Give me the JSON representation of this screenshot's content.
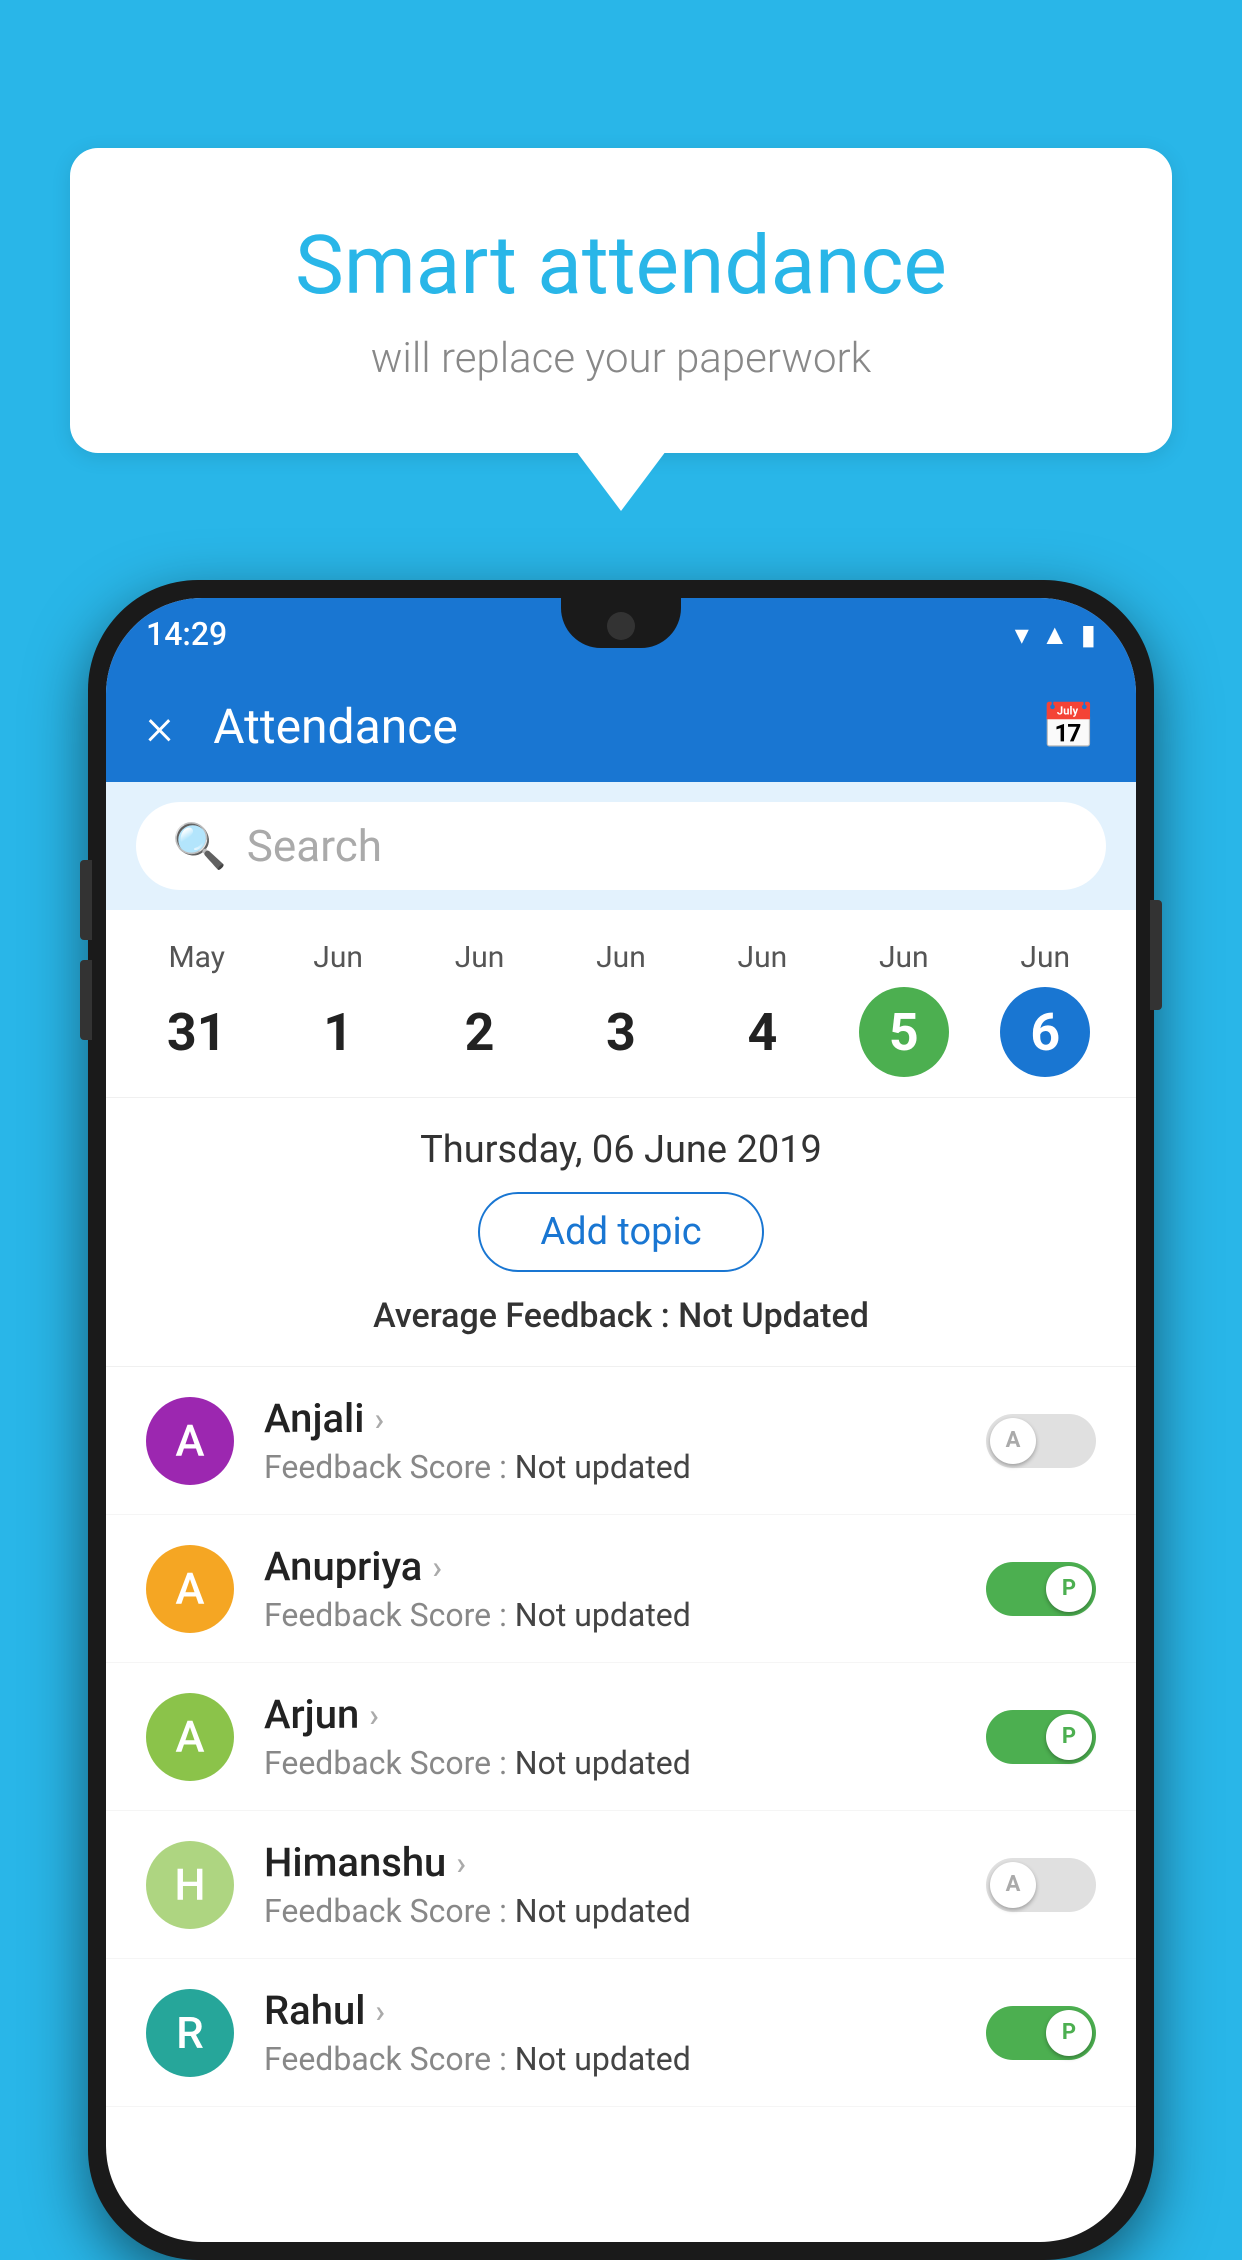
{
  "background": {
    "color": "#29b6e8"
  },
  "speech_bubble": {
    "title": "Smart attendance",
    "subtitle": "will replace your paperwork"
  },
  "phone": {
    "status_bar": {
      "time": "14:29",
      "icons": [
        "wifi",
        "signal",
        "battery"
      ]
    },
    "app_bar": {
      "title": "Attendance",
      "close_label": "×",
      "calendar_icon": "📅"
    },
    "search": {
      "placeholder": "Search"
    },
    "calendar": {
      "days": [
        {
          "month": "May",
          "date": "31",
          "style": "normal"
        },
        {
          "month": "Jun",
          "date": "1",
          "style": "normal"
        },
        {
          "month": "Jun",
          "date": "2",
          "style": "normal"
        },
        {
          "month": "Jun",
          "date": "3",
          "style": "normal"
        },
        {
          "month": "Jun",
          "date": "4",
          "style": "normal"
        },
        {
          "month": "Jun",
          "date": "5",
          "style": "green"
        },
        {
          "month": "Jun",
          "date": "6",
          "style": "blue"
        }
      ]
    },
    "selected_date": {
      "label": "Thursday, 06 June 2019",
      "add_topic_btn": "Add topic",
      "avg_feedback_label": "Average Feedback : ",
      "avg_feedback_value": "Not Updated"
    },
    "students": [
      {
        "name": "Anjali",
        "avatar_letter": "A",
        "avatar_color": "purple",
        "feedback_label": "Feedback Score : ",
        "feedback_value": "Not updated",
        "toggle": "off",
        "toggle_letter": "A"
      },
      {
        "name": "Anupriya",
        "avatar_letter": "A",
        "avatar_color": "yellow",
        "feedback_label": "Feedback Score : ",
        "feedback_value": "Not updated",
        "toggle": "on",
        "toggle_letter": "P"
      },
      {
        "name": "Arjun",
        "avatar_letter": "A",
        "avatar_color": "green",
        "feedback_label": "Feedback Score : ",
        "feedback_value": "Not updated",
        "toggle": "on",
        "toggle_letter": "P"
      },
      {
        "name": "Himanshu",
        "avatar_letter": "H",
        "avatar_color": "light-green",
        "feedback_label": "Feedback Score : ",
        "feedback_value": "Not updated",
        "toggle": "off",
        "toggle_letter": "A"
      },
      {
        "name": "Rahul",
        "avatar_letter": "R",
        "avatar_color": "teal",
        "feedback_label": "Feedback Score : ",
        "feedback_value": "Not updated",
        "toggle": "on",
        "toggle_letter": "P"
      }
    ]
  }
}
